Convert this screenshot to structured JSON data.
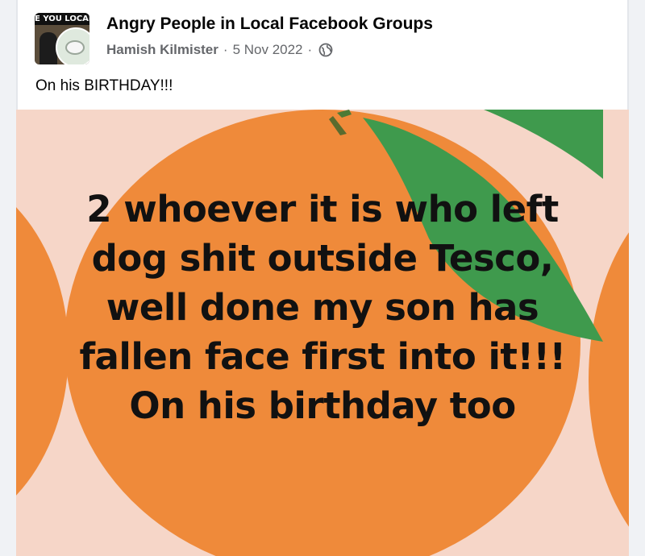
{
  "post": {
    "avatar_banner": "E YOU LOCAL",
    "group_name": "Angry People in Local Facebook Groups",
    "author": "Hamish Kilmister",
    "separator": "·",
    "date": "5 Nov 2022",
    "privacy_icon": "globe-icon",
    "caption": "On his BIRTHDAY!!!"
  },
  "image": {
    "lines": [
      "2 whoever it is who left",
      "dog shit outside Tesco,",
      "well done my son has",
      "fallen face first into it!!!",
      "On his birthday too"
    ],
    "colors": {
      "background": "#f6d6c8",
      "orange": "#ef8a3a",
      "leaf": "#3f9a4d"
    }
  }
}
